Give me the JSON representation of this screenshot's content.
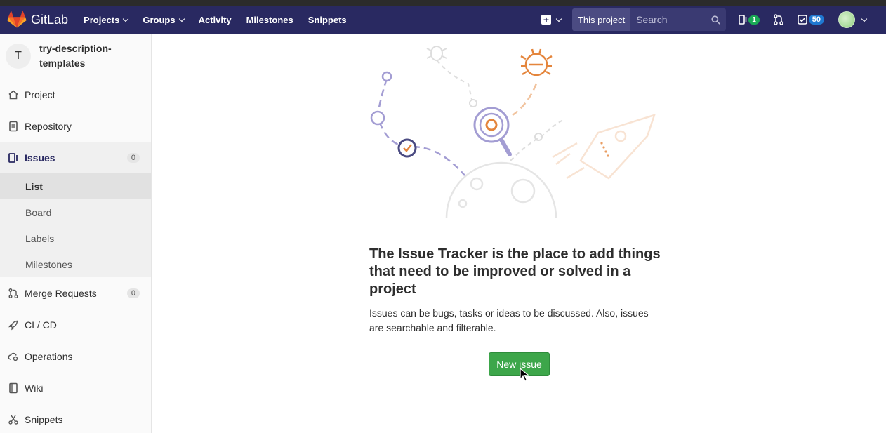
{
  "navbar": {
    "brand": "GitLab",
    "links": [
      {
        "label": "Projects",
        "dropdown": true
      },
      {
        "label": "Groups",
        "dropdown": true
      },
      {
        "label": "Activity",
        "dropdown": false
      },
      {
        "label": "Milestones",
        "dropdown": false
      },
      {
        "label": "Snippets",
        "dropdown": false
      }
    ],
    "search_scope": "This project",
    "search_placeholder": "Search",
    "issues_count": "1",
    "todos_count": "50"
  },
  "sidebar": {
    "project_avatar_letter": "T",
    "project_name": "try-description-templates",
    "items": [
      {
        "label": "Project",
        "icon": "home-icon"
      },
      {
        "label": "Repository",
        "icon": "document-icon"
      },
      {
        "label": "Issues",
        "icon": "issues-icon",
        "count": "0",
        "active": true
      },
      {
        "label": "Merge Requests",
        "icon": "merge-request-icon",
        "count": "0"
      },
      {
        "label": "CI / CD",
        "icon": "rocket-icon"
      },
      {
        "label": "Operations",
        "icon": "cloud-gear-icon"
      },
      {
        "label": "Wiki",
        "icon": "book-icon"
      },
      {
        "label": "Snippets",
        "icon": "scissors-icon"
      }
    ],
    "issues_sub": [
      {
        "label": "List",
        "active": true
      },
      {
        "label": "Board"
      },
      {
        "label": "Labels"
      },
      {
        "label": "Milestones"
      }
    ]
  },
  "main": {
    "title": "The Issue Tracker is the place to add things that need to be improved or solved in a project",
    "description": "Issues can be bugs, tasks or ideas to be discussed. Also, issues are searchable and filterable.",
    "new_issue_label": "New issue"
  },
  "colors": {
    "navbar": "#292961",
    "button_green": "#3da64a",
    "accent_orange": "#e4853c",
    "accent_purple": "#a39dd3"
  }
}
